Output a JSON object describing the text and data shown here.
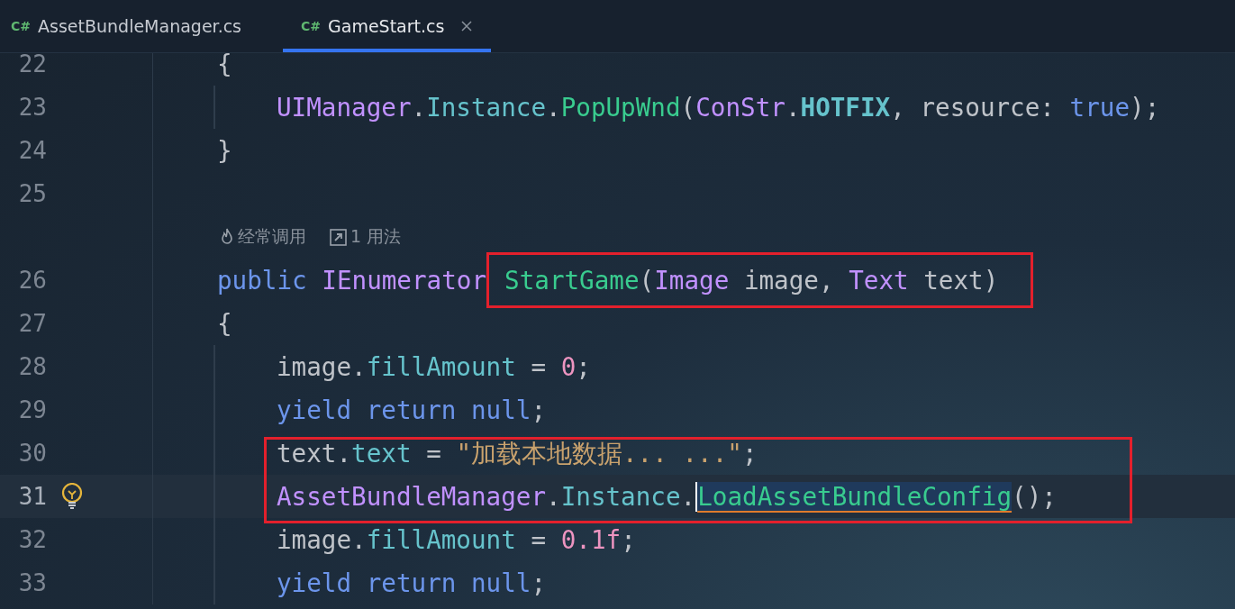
{
  "tabs": [
    {
      "badge": "C#",
      "label": "AssetBundleManager.cs",
      "selected": false
    },
    {
      "badge": "C#",
      "label": "GameStart.cs",
      "selected": true
    }
  ],
  "lines": [
    {
      "kind": "code",
      "number": "22",
      "indent": false,
      "current": false,
      "bulb": false,
      "tokens": [
        {
          "kind": "plain",
          "text": "{"
        }
      ]
    },
    {
      "kind": "code",
      "number": "23",
      "indent": true,
      "current": false,
      "bulb": false,
      "tokens": [
        {
          "kind": "type",
          "text": "UIManager"
        },
        {
          "kind": "plain",
          "text": "."
        },
        {
          "kind": "field",
          "text": "Instance"
        },
        {
          "kind": "plain",
          "text": "."
        },
        {
          "kind": "method",
          "text": "PopUpWnd"
        },
        {
          "kind": "plain",
          "text": "("
        },
        {
          "kind": "type",
          "text": "ConStr"
        },
        {
          "kind": "plain",
          "text": "."
        },
        {
          "kind": "constant",
          "text": "HOTFIX"
        },
        {
          "kind": "plain",
          "text": ", "
        },
        {
          "kind": "param",
          "text": "resource: "
        },
        {
          "kind": "keyword",
          "text": "true"
        },
        {
          "kind": "plain",
          "text": ");"
        }
      ]
    },
    {
      "kind": "code",
      "number": "24",
      "indent": false,
      "current": false,
      "bulb": false,
      "tokens": [
        {
          "kind": "plain",
          "text": "}"
        }
      ]
    },
    {
      "kind": "code",
      "number": "25",
      "indent": false,
      "current": false,
      "bulb": false
    },
    {
      "kind": "hints",
      "items": [
        {
          "kind": "frequent",
          "text": "经常调用"
        },
        {
          "kind": "usages",
          "text": "1 用法"
        }
      ]
    },
    {
      "kind": "code",
      "number": "26",
      "indent": false,
      "current": false,
      "bulb": false,
      "tokens": [
        {
          "kind": "keyword",
          "text": "public "
        },
        {
          "kind": "type",
          "text": "IEnumerator"
        },
        {
          "kind": "frame",
          "tokens": [
            {
              "kind": "method",
              "text": "StartGame"
            },
            {
              "kind": "plain",
              "text": "("
            },
            {
              "kind": "type",
              "text": "Image"
            },
            {
              "kind": "plain",
              "text": " image, "
            },
            {
              "kind": "type",
              "text": "Text"
            },
            {
              "kind": "plain",
              "text": " text)"
            }
          ]
        }
      ]
    },
    {
      "kind": "code",
      "number": "27",
      "indent": false,
      "current": false,
      "bulb": false,
      "tokens": [
        {
          "kind": "plain",
          "text": "{"
        }
      ]
    },
    {
      "kind": "code",
      "number": "28",
      "indent": true,
      "current": false,
      "bulb": false,
      "tokens": [
        {
          "kind": "plain",
          "text": "image."
        },
        {
          "kind": "field",
          "text": "fillAmount"
        },
        {
          "kind": "plain",
          "text": " = "
        },
        {
          "kind": "number",
          "text": "0"
        },
        {
          "kind": "plain",
          "text": ";"
        }
      ]
    },
    {
      "kind": "code",
      "number": "29",
      "indent": true,
      "current": false,
      "bulb": false,
      "tokens": [
        {
          "kind": "keyword",
          "text": "yield return null"
        },
        {
          "kind": "plain",
          "text": ";"
        }
      ]
    },
    {
      "kind": "frame",
      "lines": [
        {
          "kind": "code",
          "number": "30",
          "indent": true,
          "current": false,
          "bulb": false,
          "tokens": [
            {
              "kind": "plain",
              "text": "text."
            },
            {
              "kind": "field",
              "text": "text"
            },
            {
              "kind": "plain",
              "text": " = "
            },
            {
              "kind": "string",
              "text": "\"加载本地数据... ...\""
            },
            {
              "kind": "plain",
              "text": ";"
            }
          ]
        },
        {
          "kind": "code",
          "number": "31",
          "indent": true,
          "current": true,
          "bulb": true,
          "tokens": [
            {
              "kind": "type",
              "text": "AssetBundleManager"
            },
            {
              "kind": "plain",
              "text": "."
            },
            {
              "kind": "field",
              "text": "Instance"
            },
            {
              "kind": "plain",
              "text": "."
            },
            {
              "kind": "selection",
              "text": "LoadAssetBundleConfig"
            },
            {
              "kind": "plain",
              "text": "();"
            }
          ]
        }
      ]
    },
    {
      "kind": "code",
      "number": "32",
      "indent": true,
      "current": false,
      "bulb": false,
      "tokens": [
        {
          "kind": "plain",
          "text": "image."
        },
        {
          "kind": "field",
          "text": "fillAmount"
        },
        {
          "kind": "plain",
          "text": " = "
        },
        {
          "kind": "number",
          "text": "0.1f"
        },
        {
          "kind": "plain",
          "text": ";"
        }
      ]
    },
    {
      "kind": "code",
      "number": "33",
      "indent": true,
      "current": false,
      "bulb": false,
      "tokens": [
        {
          "kind": "keyword",
          "text": "yield return null"
        },
        {
          "kind": "plain",
          "text": ";"
        }
      ]
    }
  ]
}
